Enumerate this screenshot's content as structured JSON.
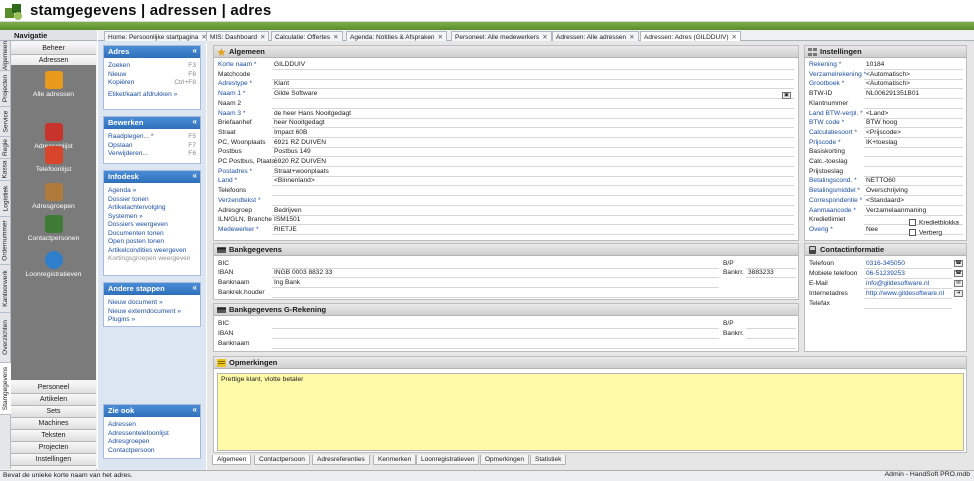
{
  "app": {
    "title": "stamgegevens | adressen | adres"
  },
  "nav": {
    "header": "Navigatie",
    "vertical_tabs": [
      "Algemeen",
      "Projecten",
      "Service",
      "Regie",
      "Kassa",
      "Logistiek",
      "Ordernummer",
      "Kantoorwerk",
      "Overzichten",
      "Stamgegevens"
    ],
    "top_buttons": [
      "Beheer",
      "Adressen"
    ],
    "icons": [
      "Alle adressen",
      "Adressenlijst",
      "Telefoonlijst",
      "Adresgroepen",
      "Contactpersonen",
      "Loonregistratieven"
    ],
    "bottom_buttons": [
      "Personeel",
      "Artikelen",
      "Sets",
      "Machines",
      "Teksten",
      "Projecten",
      "Instellingen"
    ]
  },
  "tabs": [
    "Home: Persoonlijke startpagina",
    "MIS: Dashboard",
    "Calculatie: Offertes",
    "Agenda: Notities & Afspraken",
    "Personeel: Alle medewerkers",
    "Adressen: Alle adressen",
    "Adressen: Adres (GILDDUIV)"
  ],
  "actions": {
    "adres": {
      "title": "Adres",
      "items": [
        {
          "label": "Zoeken",
          "key": "F3"
        },
        {
          "label": "Nieuw",
          "key": "F8"
        },
        {
          "label": "Kopiëren",
          "key": "Ctrl+F8"
        },
        {
          "label": "",
          "key": ""
        },
        {
          "label": "Etiket/kaart afdrukken »",
          "key": ""
        }
      ]
    },
    "bewerken": {
      "title": "Bewerken",
      "items": [
        {
          "label": "Raadplegen... *",
          "key": "F5"
        },
        {
          "label": "Opslaan",
          "key": "F7"
        },
        {
          "label": "Verwijderen...",
          "key": "F6"
        }
      ]
    },
    "infodesk": {
      "title": "Infodesk",
      "items": [
        "Agenda »",
        "Dossier tonen",
        "Artikelachtervolging",
        "Systemen »",
        "Dossiers weergeven",
        "Documenten tonen",
        "Open posten tonen",
        "Artikelcondities weergeven",
        "Kortingsgroepen weergeven"
      ]
    },
    "andere": {
      "title": "Andere stappen",
      "items": [
        "Nieuw document »",
        "Nieuw externdocument »",
        "Plugins »"
      ]
    },
    "zieook": {
      "title": "Zie ook",
      "items": [
        "Adressen",
        "Adressentelefoonlijst",
        "Adresgroepen",
        "Contactpersoon"
      ]
    }
  },
  "algemeen": {
    "title": "Algemeen",
    "rows": [
      {
        "label": "Korte naam *",
        "value": "GILDDUIV",
        "req": true
      },
      {
        "label": "Matchcode",
        "value": "",
        "req": false
      },
      {
        "label": "Adrestype *",
        "value": "Klant",
        "req": true
      },
      {
        "label": "Naam 1 *",
        "value": "Gilde Software",
        "req": true
      },
      {
        "label": "Naam 2",
        "value": "",
        "req": false
      },
      {
        "label": "Naam 3 *",
        "value": "de heer Hans Nooitgedagt",
        "req": true
      },
      {
        "label": "Briefaanhef",
        "value": "heer Nooitgedagt",
        "req": false
      },
      {
        "label": "Straat",
        "value": "Impact 60B",
        "req": false
      },
      {
        "label": "PC, Woonplaats",
        "value": "6921 RZ      DUIVEN",
        "req": false
      },
      {
        "label": "Postbus",
        "value": "Postbus 149",
        "req": false
      },
      {
        "label": "PC Postbus, Plaats",
        "value": "6920 RZ      DUIVEN",
        "req": false
      },
      {
        "label": "Postadres *",
        "value": "Straat+woonplaats",
        "req": true
      },
      {
        "label": "Land *",
        "value": "<Binnenland>",
        "req": true
      },
      {
        "label": "Telefoons",
        "value": "",
        "req": false
      },
      {
        "label": "Verzendtekst *",
        "value": "",
        "req": true
      },
      {
        "label": "Adresgroep",
        "value": "Bedrijven",
        "req": false
      },
      {
        "label": "ILN/GLN, Branche",
        "value": "ISM1501",
        "req": false
      },
      {
        "label": "Medewerker *",
        "value": "RIETJE",
        "req": true
      }
    ]
  },
  "instellingen": {
    "title": "Instellingen",
    "rows": [
      {
        "label": "Rekening *",
        "value": "10184",
        "req": true
      },
      {
        "label": "Verzamelrekening *",
        "value": "<Automatisch>",
        "req": true
      },
      {
        "label": "Grootboek *",
        "value": "<Automatisch>",
        "req": true
      },
      {
        "label": "BTW-ID",
        "value": "NL006291351B01",
        "req": false
      },
      {
        "label": "Klantnummer",
        "value": "",
        "req": false
      },
      {
        "label": "Land BTW-verpl. *",
        "value": "<Land>",
        "req": true
      },
      {
        "label": "BTW code *",
        "value": "BTW hoog",
        "req": true
      },
      {
        "label": "Calculatiesoort *",
        "value": "<Prijscode>",
        "req": true
      },
      {
        "label": "Prijscode *",
        "value": "IK+toeslag",
        "req": true
      },
      {
        "label": "Basiskorting",
        "value": "",
        "req": false
      },
      {
        "label": "Calc.-toeslag",
        "value": "",
        "req": false
      },
      {
        "label": "Prijstoeslag",
        "value": "",
        "req": false
      },
      {
        "label": "Betalingscond. *",
        "value": "NETTO60",
        "req": true
      },
      {
        "label": "Betalingsmiddel *",
        "value": "Overschrijving",
        "req": true
      },
      {
        "label": "Correspondentie *",
        "value": "<Standaard>",
        "req": true
      },
      {
        "label": "Aanmaancode *",
        "value": "Verzamelaanmaning",
        "req": true
      },
      {
        "label": "Kredietlimiet",
        "value": "",
        "req": false
      },
      {
        "label": "Overig *",
        "value": "Nee",
        "req": true
      }
    ],
    "checkboxes": [
      "Kredietblokka",
      "Verberg"
    ]
  },
  "bank": {
    "title": "Bankgegevens",
    "bic_label": "BIC",
    "iban_label": "IBAN",
    "iban": "INGB 0003 8832 33",
    "bp_label": "B/P",
    "bankrnr_label": "Bankrr.",
    "bankrnr": "3883233",
    "bankname_label": "Banknaam",
    "bankname": "Ing Bank",
    "holder_label": "Bankrek.houder"
  },
  "bankg": {
    "title": "Bankgegevens G-Rekening",
    "bic_label": "BIC",
    "iban_label": "IBAN",
    "bp_label": "B/P",
    "bankrnr_label": "Bankrr.",
    "bankname_label": "Banknaam"
  },
  "contact": {
    "title": "Contactinformatie",
    "rows": [
      {
        "label": "Telefoon",
        "value": "0316-345050"
      },
      {
        "label": "Mobiele telefoon",
        "value": "06-51239253"
      },
      {
        "label": "E-Mail",
        "value": "info@gildesoftware.nl"
      },
      {
        "label": "Internetadres",
        "value": "http://www.gildesoftware.nl"
      },
      {
        "label": "Telefax",
        "value": ""
      }
    ]
  },
  "opmerkingen": {
    "title": "Opmerkingen",
    "text": "Prettige klant, vlotte betaler"
  },
  "bottom_tabs": [
    "Algemeen",
    "Contactpersoon",
    "Adresreferenties",
    "Kenmerken",
    "Loonregistratieven",
    "Opmerkingen",
    "Statistiek"
  ],
  "status": {
    "left": "Bevat de unieke korte naam van het adres.",
    "right": "Admin - HandSoft PRO.mdb"
  }
}
